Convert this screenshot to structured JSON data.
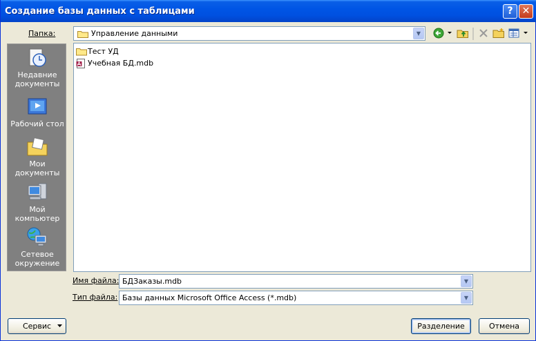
{
  "window": {
    "title": "Создание базы данных с таблицами"
  },
  "title_buttons": {
    "help": "?",
    "close": "✕"
  },
  "folder": {
    "label": "Папка:",
    "value": "Управление данными"
  },
  "places": [
    {
      "label": "Недавние документы",
      "icon": "recent-documents-icon"
    },
    {
      "label": "Рабочий стол",
      "icon": "desktop-icon"
    },
    {
      "label": "Мои документы",
      "icon": "my-documents-icon"
    },
    {
      "label": "Мой компьютер",
      "icon": "my-computer-icon"
    },
    {
      "label": "Сетевое окружение",
      "icon": "network-icon"
    }
  ],
  "files": [
    {
      "name": "Тест УД",
      "type": "folder"
    },
    {
      "name": "Учебная БД.mdb",
      "type": "access-db"
    }
  ],
  "filename": {
    "label": "Имя файла:",
    "value": "БДЗаказы.mdb"
  },
  "filetype": {
    "label": "Тип файла:",
    "value": "Базы данных Microsoft Office Access (*.mdb)"
  },
  "buttons": {
    "tools": "Сервис",
    "share": "Разделение",
    "cancel": "Отмена"
  },
  "colors": {
    "titlebar": "#0055e5",
    "places_bg": "#808080",
    "dialog_bg": "#ece9d8"
  }
}
